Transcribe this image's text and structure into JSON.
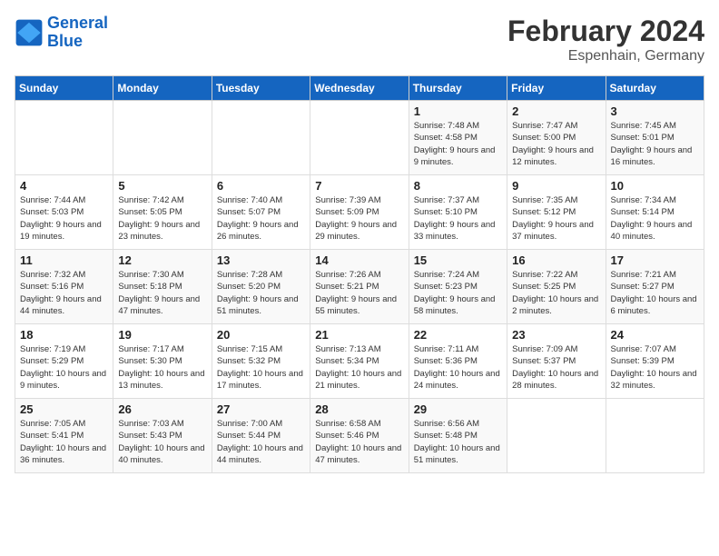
{
  "logo": {
    "line1": "General",
    "line2": "Blue"
  },
  "title": "February 2024",
  "location": "Espenhain, Germany",
  "days_of_week": [
    "Sunday",
    "Monday",
    "Tuesday",
    "Wednesday",
    "Thursday",
    "Friday",
    "Saturday"
  ],
  "weeks": [
    [
      {
        "day": "",
        "info": ""
      },
      {
        "day": "",
        "info": ""
      },
      {
        "day": "",
        "info": ""
      },
      {
        "day": "",
        "info": ""
      },
      {
        "day": "1",
        "info": "Sunrise: 7:48 AM\nSunset: 4:58 PM\nDaylight: 9 hours\nand 9 minutes."
      },
      {
        "day": "2",
        "info": "Sunrise: 7:47 AM\nSunset: 5:00 PM\nDaylight: 9 hours\nand 12 minutes."
      },
      {
        "day": "3",
        "info": "Sunrise: 7:45 AM\nSunset: 5:01 PM\nDaylight: 9 hours\nand 16 minutes."
      }
    ],
    [
      {
        "day": "4",
        "info": "Sunrise: 7:44 AM\nSunset: 5:03 PM\nDaylight: 9 hours\nand 19 minutes."
      },
      {
        "day": "5",
        "info": "Sunrise: 7:42 AM\nSunset: 5:05 PM\nDaylight: 9 hours\nand 23 minutes."
      },
      {
        "day": "6",
        "info": "Sunrise: 7:40 AM\nSunset: 5:07 PM\nDaylight: 9 hours\nand 26 minutes."
      },
      {
        "day": "7",
        "info": "Sunrise: 7:39 AM\nSunset: 5:09 PM\nDaylight: 9 hours\nand 29 minutes."
      },
      {
        "day": "8",
        "info": "Sunrise: 7:37 AM\nSunset: 5:10 PM\nDaylight: 9 hours\nand 33 minutes."
      },
      {
        "day": "9",
        "info": "Sunrise: 7:35 AM\nSunset: 5:12 PM\nDaylight: 9 hours\nand 37 minutes."
      },
      {
        "day": "10",
        "info": "Sunrise: 7:34 AM\nSunset: 5:14 PM\nDaylight: 9 hours\nand 40 minutes."
      }
    ],
    [
      {
        "day": "11",
        "info": "Sunrise: 7:32 AM\nSunset: 5:16 PM\nDaylight: 9 hours\nand 44 minutes."
      },
      {
        "day": "12",
        "info": "Sunrise: 7:30 AM\nSunset: 5:18 PM\nDaylight: 9 hours\nand 47 minutes."
      },
      {
        "day": "13",
        "info": "Sunrise: 7:28 AM\nSunset: 5:20 PM\nDaylight: 9 hours\nand 51 minutes."
      },
      {
        "day": "14",
        "info": "Sunrise: 7:26 AM\nSunset: 5:21 PM\nDaylight: 9 hours\nand 55 minutes."
      },
      {
        "day": "15",
        "info": "Sunrise: 7:24 AM\nSunset: 5:23 PM\nDaylight: 9 hours\nand 58 minutes."
      },
      {
        "day": "16",
        "info": "Sunrise: 7:22 AM\nSunset: 5:25 PM\nDaylight: 10 hours\nand 2 minutes."
      },
      {
        "day": "17",
        "info": "Sunrise: 7:21 AM\nSunset: 5:27 PM\nDaylight: 10 hours\nand 6 minutes."
      }
    ],
    [
      {
        "day": "18",
        "info": "Sunrise: 7:19 AM\nSunset: 5:29 PM\nDaylight: 10 hours\nand 9 minutes."
      },
      {
        "day": "19",
        "info": "Sunrise: 7:17 AM\nSunset: 5:30 PM\nDaylight: 10 hours\nand 13 minutes."
      },
      {
        "day": "20",
        "info": "Sunrise: 7:15 AM\nSunset: 5:32 PM\nDaylight: 10 hours\nand 17 minutes."
      },
      {
        "day": "21",
        "info": "Sunrise: 7:13 AM\nSunset: 5:34 PM\nDaylight: 10 hours\nand 21 minutes."
      },
      {
        "day": "22",
        "info": "Sunrise: 7:11 AM\nSunset: 5:36 PM\nDaylight: 10 hours\nand 24 minutes."
      },
      {
        "day": "23",
        "info": "Sunrise: 7:09 AM\nSunset: 5:37 PM\nDaylight: 10 hours\nand 28 minutes."
      },
      {
        "day": "24",
        "info": "Sunrise: 7:07 AM\nSunset: 5:39 PM\nDaylight: 10 hours\nand 32 minutes."
      }
    ],
    [
      {
        "day": "25",
        "info": "Sunrise: 7:05 AM\nSunset: 5:41 PM\nDaylight: 10 hours\nand 36 minutes."
      },
      {
        "day": "26",
        "info": "Sunrise: 7:03 AM\nSunset: 5:43 PM\nDaylight: 10 hours\nand 40 minutes."
      },
      {
        "day": "27",
        "info": "Sunrise: 7:00 AM\nSunset: 5:44 PM\nDaylight: 10 hours\nand 44 minutes."
      },
      {
        "day": "28",
        "info": "Sunrise: 6:58 AM\nSunset: 5:46 PM\nDaylight: 10 hours\nand 47 minutes."
      },
      {
        "day": "29",
        "info": "Sunrise: 6:56 AM\nSunset: 5:48 PM\nDaylight: 10 hours\nand 51 minutes."
      },
      {
        "day": "",
        "info": ""
      },
      {
        "day": "",
        "info": ""
      }
    ]
  ]
}
